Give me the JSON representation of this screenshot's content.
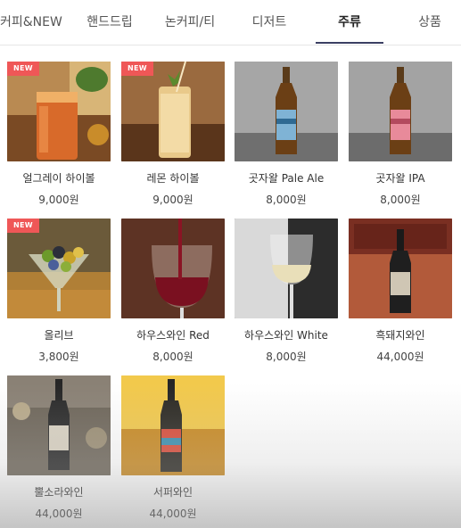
{
  "tabs": [
    {
      "label": "커피&NEW"
    },
    {
      "label": "핸드드립"
    },
    {
      "label": "논커피/티"
    },
    {
      "label": "디저트"
    },
    {
      "label": "주류"
    },
    {
      "label": "상품"
    }
  ],
  "active_tab": "주류",
  "badge_text": "NEW",
  "products": [
    {
      "name": "얼그레이 하이볼",
      "price": "9,000원",
      "badge": "NEW"
    },
    {
      "name": "레몬 하이볼",
      "price": "9,000원",
      "badge": "NEW"
    },
    {
      "name": "곳자왈 Pale Ale",
      "price": "8,000원"
    },
    {
      "name": "곳자왈 IPA",
      "price": "8,000원"
    },
    {
      "name": "올리브",
      "price": "3,800원",
      "badge": "NEW"
    },
    {
      "name": "하우스와인 Red",
      "price": "8,000원"
    },
    {
      "name": "하우스와인 White",
      "price": "8,000원"
    },
    {
      "name": "흑돼지와인",
      "price": "44,000원"
    },
    {
      "name": "뿔소라와인",
      "price": "44,000원"
    },
    {
      "name": "서퍼와인",
      "price": "44,000원"
    }
  ],
  "colors": {
    "badge": "#ef5757",
    "active_underline": "#3b3f63"
  }
}
